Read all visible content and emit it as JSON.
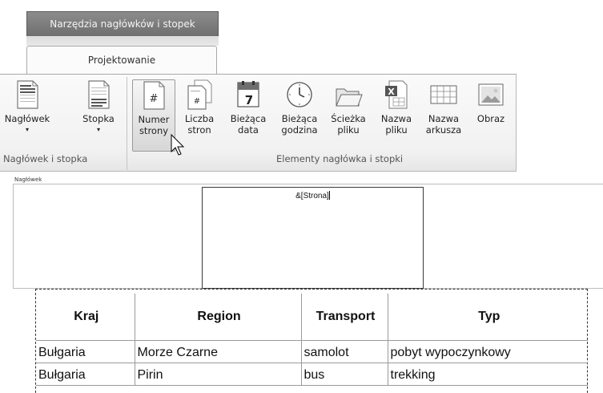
{
  "ribbon": {
    "contextual_title": "Narzędzia nagłówków i stopek",
    "active_tab": "Projektowanie",
    "groups": [
      {
        "label": "Nagłówek i stopka",
        "buttons": [
          {
            "label1": "Nagłówek",
            "label2": "▾",
            "icon": "header-page-icon"
          },
          {
            "label1": "Stopka",
            "label2": "▾",
            "icon": "footer-page-icon"
          }
        ]
      },
      {
        "label": "Elementy nagłówka i stopki",
        "buttons": [
          {
            "label1": "Numer",
            "label2": "strony",
            "icon": "page-number-icon"
          },
          {
            "label1": "Liczba",
            "label2": "stron",
            "icon": "page-count-icon"
          },
          {
            "label1": "Bieżąca",
            "label2": "data",
            "icon": "calendar-icon"
          },
          {
            "label1": "Bieżąca",
            "label2": "godzina",
            "icon": "clock-icon"
          },
          {
            "label1": "Ścieżka",
            "label2": "pliku",
            "icon": "folder-icon"
          },
          {
            "label1": "Nazwa",
            "label2": "pliku",
            "icon": "excel-file-icon"
          },
          {
            "label1": "Nazwa",
            "label2": "arkusza",
            "icon": "sheet-grid-icon"
          },
          {
            "label1": "Obraz",
            "label2": "",
            "icon": "picture-icon"
          }
        ]
      }
    ]
  },
  "sheet": {
    "header_label": "Nagłówek",
    "header_center_code": "&[Strona]"
  },
  "table": {
    "columns": [
      "Kraj",
      "Region",
      "Transport",
      "Typ"
    ],
    "rows": [
      [
        "Bułgaria",
        "Morze Czarne",
        "samolot",
        "pobyt wypoczynkowy"
      ],
      [
        "Bułgaria",
        "Pirin",
        "bus",
        "trekking"
      ]
    ]
  }
}
